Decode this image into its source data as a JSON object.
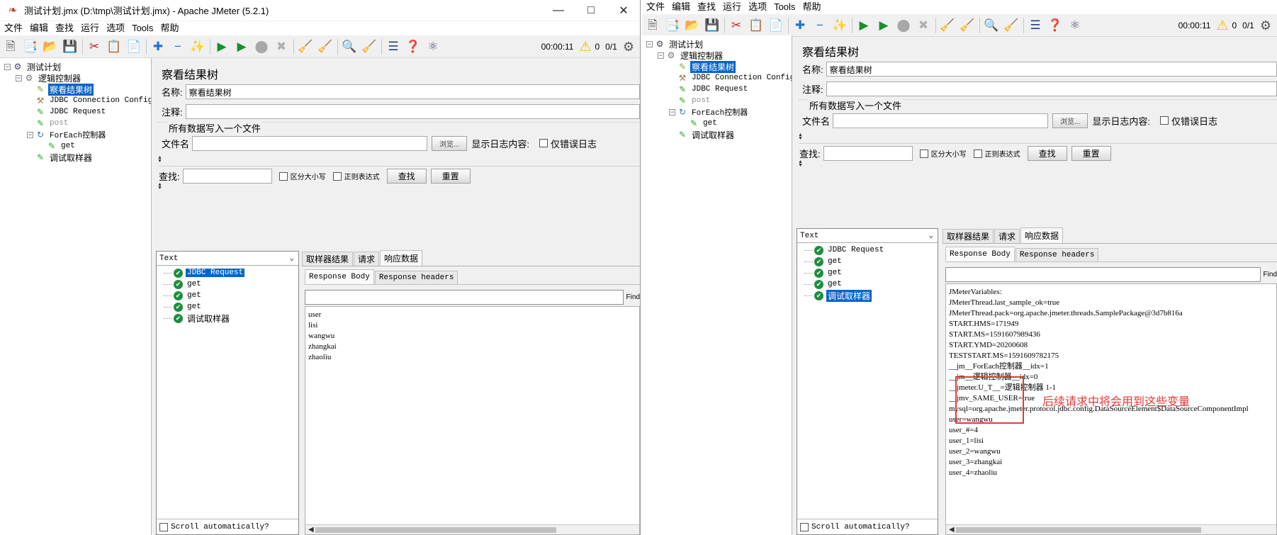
{
  "accent_select": "#0a64c8",
  "annotation_color": "#e53935",
  "annotation": "后续请求中将会用到这些变量",
  "windows": [
    {
      "title": "测试计划.jmx (D:\\tmp\\测试计划.jmx) - Apache JMeter (5.2.1)",
      "window_buttons": [
        "minimize-icon",
        "maximize-icon",
        "close-icon"
      ],
      "menu": [
        "文件",
        "编辑",
        "查找",
        "运行",
        "选项",
        "Tools",
        "帮助"
      ],
      "toolbar_status": {
        "elapsed": "00:00:11",
        "errors": "0",
        "threads": "0/1"
      },
      "tree": [
        {
          "label": "测试计划",
          "level": 0,
          "icon": "test-plan-icon",
          "toggle": "−"
        },
        {
          "label": "逻辑控制器",
          "level": 1,
          "icon": "thread-group-icon",
          "toggle": "−"
        },
        {
          "label": "察看结果树",
          "level": 2,
          "icon": "listener-icon",
          "selected": true
        },
        {
          "label": "JDBC Connection Configuration",
          "level": 2,
          "icon": "config-icon",
          "mono": true
        },
        {
          "label": "JDBC Request",
          "level": 2,
          "icon": "sampler-icon",
          "mono": true
        },
        {
          "label": "post",
          "level": 2,
          "icon": "sampler-icon",
          "mono": true,
          "disabled": true
        },
        {
          "label": "ForEach控制器",
          "level": 2,
          "icon": "foreach-icon",
          "toggle": "−",
          "mono": true
        },
        {
          "label": "get",
          "level": 3,
          "icon": "sampler-icon",
          "mono": true
        },
        {
          "label": "调试取样器",
          "level": 2,
          "icon": "sampler-icon"
        }
      ],
      "panel": {
        "title": "察看结果树",
        "name_label": "名称:",
        "name_value": "察看结果树",
        "comment_label": "注释:",
        "comment_value": "",
        "file_section": "所有数据写入一个文件",
        "filename_label": "文件名",
        "browse": "浏览...",
        "log_label": "显示日志内容:",
        "errors_only": "仅错误日志",
        "search_label": "查找:",
        "case": "区分大小写",
        "regex": "正则表达式",
        "find_btn": "查找",
        "reset_btn": "重置"
      },
      "results": {
        "renderer": "Text",
        "tree": [
          {
            "label": "JDBC Request",
            "selected": true,
            "mono": true
          },
          {
            "label": "get",
            "mono": true
          },
          {
            "label": "get",
            "mono": true
          },
          {
            "label": "get",
            "mono": true
          },
          {
            "label": "调试取样器"
          }
        ],
        "scroll_auto": "Scroll automatically?",
        "tabs": [
          "取样器结果",
          "请求",
          "响应数据"
        ],
        "subtabs": [
          "Response Body",
          "Response headers"
        ],
        "find": "Find",
        "body": [
          "user",
          "lisi",
          "wangwu",
          "zhangkai",
          "zhaoliu"
        ]
      }
    },
    {
      "menu": [
        "文件",
        "编辑",
        "查找",
        "运行",
        "选项",
        "Tools",
        "帮助"
      ],
      "toolbar_status": {
        "elapsed": "00:00:11",
        "errors": "0",
        "threads": "0/1"
      },
      "tree": [
        {
          "label": "测试计划",
          "level": 0,
          "icon": "test-plan-icon",
          "toggle": "−"
        },
        {
          "label": "逻辑控制器",
          "level": 1,
          "icon": "thread-group-icon",
          "toggle": "−"
        },
        {
          "label": "察看结果树",
          "level": 2,
          "icon": "listener-icon",
          "selected": true
        },
        {
          "label": "JDBC Connection Configuration",
          "level": 2,
          "icon": "config-icon",
          "mono": true
        },
        {
          "label": "JDBC Request",
          "level": 2,
          "icon": "sampler-icon",
          "mono": true
        },
        {
          "label": "post",
          "level": 2,
          "icon": "sampler-icon",
          "mono": true,
          "disabled": true
        },
        {
          "label": "ForEach控制器",
          "level": 2,
          "icon": "foreach-icon",
          "toggle": "−",
          "mono": true
        },
        {
          "label": "get",
          "level": 3,
          "icon": "sampler-icon",
          "mono": true
        },
        {
          "label": "调试取样器",
          "level": 2,
          "icon": "sampler-icon"
        }
      ],
      "panel": {
        "title": "察看结果树",
        "name_label": "名称:",
        "name_value": "察看结果树",
        "comment_label": "注释:",
        "comment_value": "",
        "file_section": "所有数据写入一个文件",
        "filename_label": "文件名",
        "browse": "浏览...",
        "log_label": "显示日志内容:",
        "errors_only": "仅错误日志",
        "search_label": "查找:",
        "case": "区分大小写",
        "regex": "正则表达式",
        "find_btn": "查找",
        "reset_btn": "重置"
      },
      "results": {
        "renderer": "Text",
        "tree": [
          {
            "label": "JDBC Request",
            "mono": true
          },
          {
            "label": "get",
            "mono": true
          },
          {
            "label": "get",
            "mono": true
          },
          {
            "label": "get",
            "mono": true
          },
          {
            "label": "调试取样器",
            "selected": true
          }
        ],
        "scroll_auto": "Scroll automatically?",
        "tabs": [
          "取样器结果",
          "请求",
          "响应数据"
        ],
        "subtabs": [
          "Response Body",
          "Response headers"
        ],
        "find": "Find",
        "body": [
          "JMeterVariables:",
          "JMeterThread.last_sample_ok=true",
          "JMeterThread.pack=org.apache.jmeter.threads.SamplePackage@3d7b816a",
          "START.HMS=171949",
          "START.MS=1591607989436",
          "START.YMD=20200608",
          "TESTSTART.MS=1591609782175",
          "__jm__ForEach控制器__idx=1",
          "__jm__逻辑控制器__idx=0",
          "__jmeter.U_T__=逻辑控制器 1-1",
          "__jmv_SAME_USER=true",
          "mysql=org.apache.jmeter.protocol.jdbc.config.DataSourceElement$DataSourceComponentImpl",
          "user=wangwu",
          "user_#=4",
          "user_1=lisi",
          "user_2=wangwu",
          "user_3=zhangkai",
          "user_4=zhaoliu"
        ]
      }
    }
  ]
}
